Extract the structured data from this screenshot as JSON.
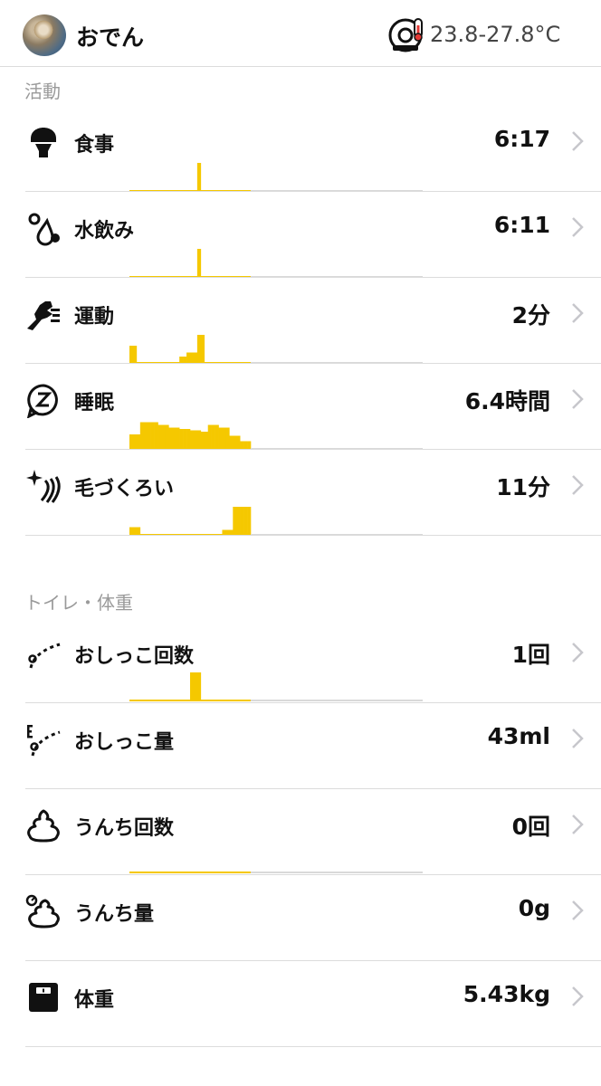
{
  "header": {
    "pet_name": "おでん",
    "temperature": "23.8-27.8°C"
  },
  "sections": {
    "activity_label": "活動",
    "toilet_label": "トイレ・体重"
  },
  "rows": {
    "meal": {
      "label": "食事",
      "value": "6:17",
      "icon": "bowl-icon",
      "bars": [
        0,
        0,
        0,
        0,
        0,
        0,
        0,
        0,
        0,
        0,
        0,
        0,
        0,
        0,
        0,
        0,
        0,
        0,
        0,
        1.0,
        0,
        0,
        0,
        0,
        0,
        0,
        0,
        0,
        0,
        0,
        0,
        0,
        0,
        0
      ]
    },
    "drink": {
      "label": "水飲み",
      "value": "6:11",
      "icon": "water-drops-icon",
      "bars": [
        0,
        0,
        0,
        0,
        0,
        0,
        0,
        0,
        0,
        0,
        0,
        0,
        0,
        0,
        0,
        0,
        0,
        0,
        0,
        1.0,
        0,
        0,
        0,
        0,
        0,
        0,
        0,
        0,
        0,
        0,
        0,
        0,
        0,
        0
      ]
    },
    "exercise": {
      "label": "運動",
      "value": "2分",
      "icon": "running-cat-icon",
      "bars": [
        0.6,
        0.6,
        0,
        0,
        0,
        0,
        0,
        0,
        0,
        0,
        0,
        0,
        0,
        0,
        0.2,
        0.2,
        0.35,
        0.35,
        0.35,
        1.0,
        1.0,
        0,
        0,
        0,
        0,
        0,
        0,
        0,
        0,
        0,
        0,
        0,
        0,
        0
      ]
    },
    "sleep": {
      "label": "睡眠",
      "value": "6.4時間",
      "icon": "sleep-z-icon",
      "bars": [
        0.5,
        0.5,
        0.5,
        0.95,
        0.95,
        0.95,
        0.95,
        0.95,
        0.85,
        0.85,
        0.85,
        0.75,
        0.75,
        0.75,
        0.7,
        0.7,
        0.7,
        0.65,
        0.65,
        0.65,
        0.6,
        0.6,
        0.85,
        0.85,
        0.85,
        0.75,
        0.75,
        0.75,
        0.45,
        0.45,
        0.45,
        0.25,
        0.25,
        0.25
      ]
    },
    "grooming": {
      "label": "毛づくろい",
      "value": "11分",
      "icon": "sparkle-lick-icon",
      "bars": [
        0.25,
        0.25,
        0.25,
        0,
        0,
        0,
        0,
        0,
        0,
        0,
        0,
        0,
        0,
        0,
        0,
        0,
        0,
        0,
        0,
        0,
        0,
        0,
        0,
        0,
        0,
        0,
        0.15,
        0.15,
        0.15,
        1.0,
        1.0,
        1.0,
        1.0,
        1.0
      ]
    },
    "pee_count": {
      "label": "おしっこ回数",
      "value": "1回",
      "icon": "pee-drops-icon",
      "bars": [
        0,
        0,
        0,
        0,
        0,
        0,
        0,
        0,
        0,
        0,
        0,
        0,
        0,
        0,
        0,
        0,
        0,
        1.0,
        1.0,
        1.0,
        0,
        0,
        0,
        0,
        0,
        0,
        0,
        0,
        0,
        0,
        0,
        0,
        0,
        0
      ]
    },
    "pee_amount": {
      "label": "おしっこ量",
      "value": "43ml",
      "icon": "pee-amount-icon",
      "bars": null
    },
    "poop_count": {
      "label": "うんち回数",
      "value": "0回",
      "icon": "poop-icon",
      "bars": [
        0,
        0,
        0,
        0,
        0,
        0,
        0,
        0,
        0,
        0,
        0,
        0,
        0,
        0,
        0,
        0,
        0,
        0,
        0,
        0,
        0,
        0,
        0,
        0,
        0,
        0,
        0,
        0,
        0,
        0,
        0,
        0,
        0,
        0
      ]
    },
    "poop_amount": {
      "label": "うんち量",
      "value": "0g",
      "icon": "poop-amount-icon",
      "bars": null
    },
    "weight": {
      "label": "体重",
      "value": "5.43kg",
      "icon": "scale-icon",
      "bars": null
    }
  },
  "colors": {
    "accent": "#f5c800",
    "baseline": "#d9d9d9",
    "chevron": "#c7c7cc"
  }
}
